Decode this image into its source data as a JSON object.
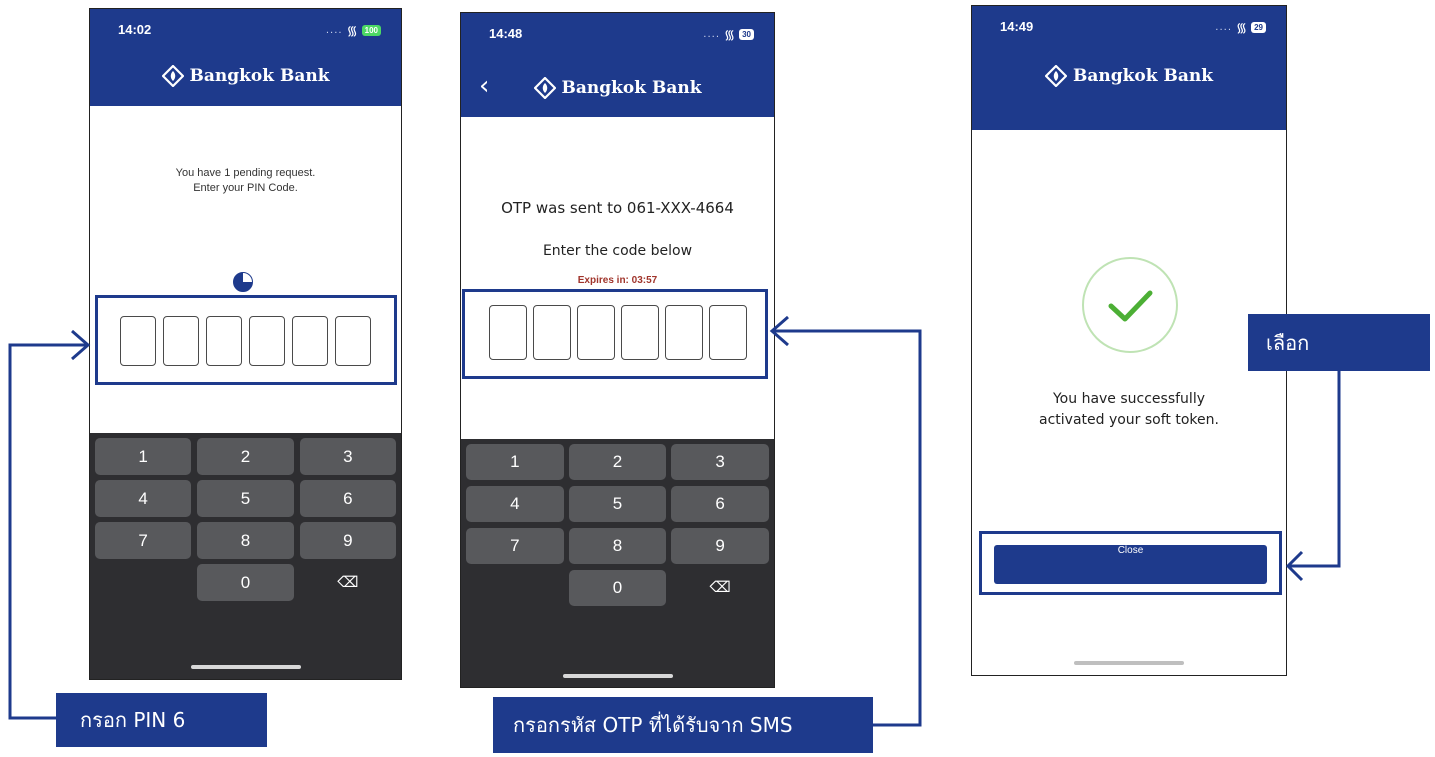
{
  "colors": {
    "brand_blue": "#1e3a8c",
    "keypad_bg": "#2e2e31",
    "key_bg": "#58595c",
    "expires_red": "#a0342b",
    "check_green": "#4caf35"
  },
  "phone1": {
    "time": "14:02",
    "battery": "100",
    "brand": "Bangkok Bank",
    "message_line1": "You have 1 pending request.",
    "message_line2": "Enter your PIN Code.",
    "pin_length": 6,
    "keys": [
      "1",
      "2",
      "3",
      "4",
      "5",
      "6",
      "7",
      "8",
      "9",
      "",
      "0",
      "⌫"
    ]
  },
  "phone2": {
    "time": "14:48",
    "battery": "30",
    "brand": "Bangkok Bank",
    "back_icon": "chevron-left-icon",
    "otp_sent": "OTP was sent to 061-XXX-4664",
    "enter_code": "Enter the code below",
    "expires": "Expires in:  03:57",
    "otp_length": 6,
    "keys": [
      "1",
      "2",
      "3",
      "4",
      "5",
      "6",
      "7",
      "8",
      "9",
      "",
      "0",
      "⌫"
    ]
  },
  "phone3": {
    "time": "14:49",
    "battery": "29",
    "brand": "Bangkok Bank",
    "success_line1": "You have successfully",
    "success_line2": "activated your soft token.",
    "close_label": "Close"
  },
  "annotations": {
    "pin_label": "กรอก PIN 6",
    "otp_label": "กรอกรหัส OTP ที่ได้รับจาก SMS",
    "select_label": "เลือก"
  }
}
